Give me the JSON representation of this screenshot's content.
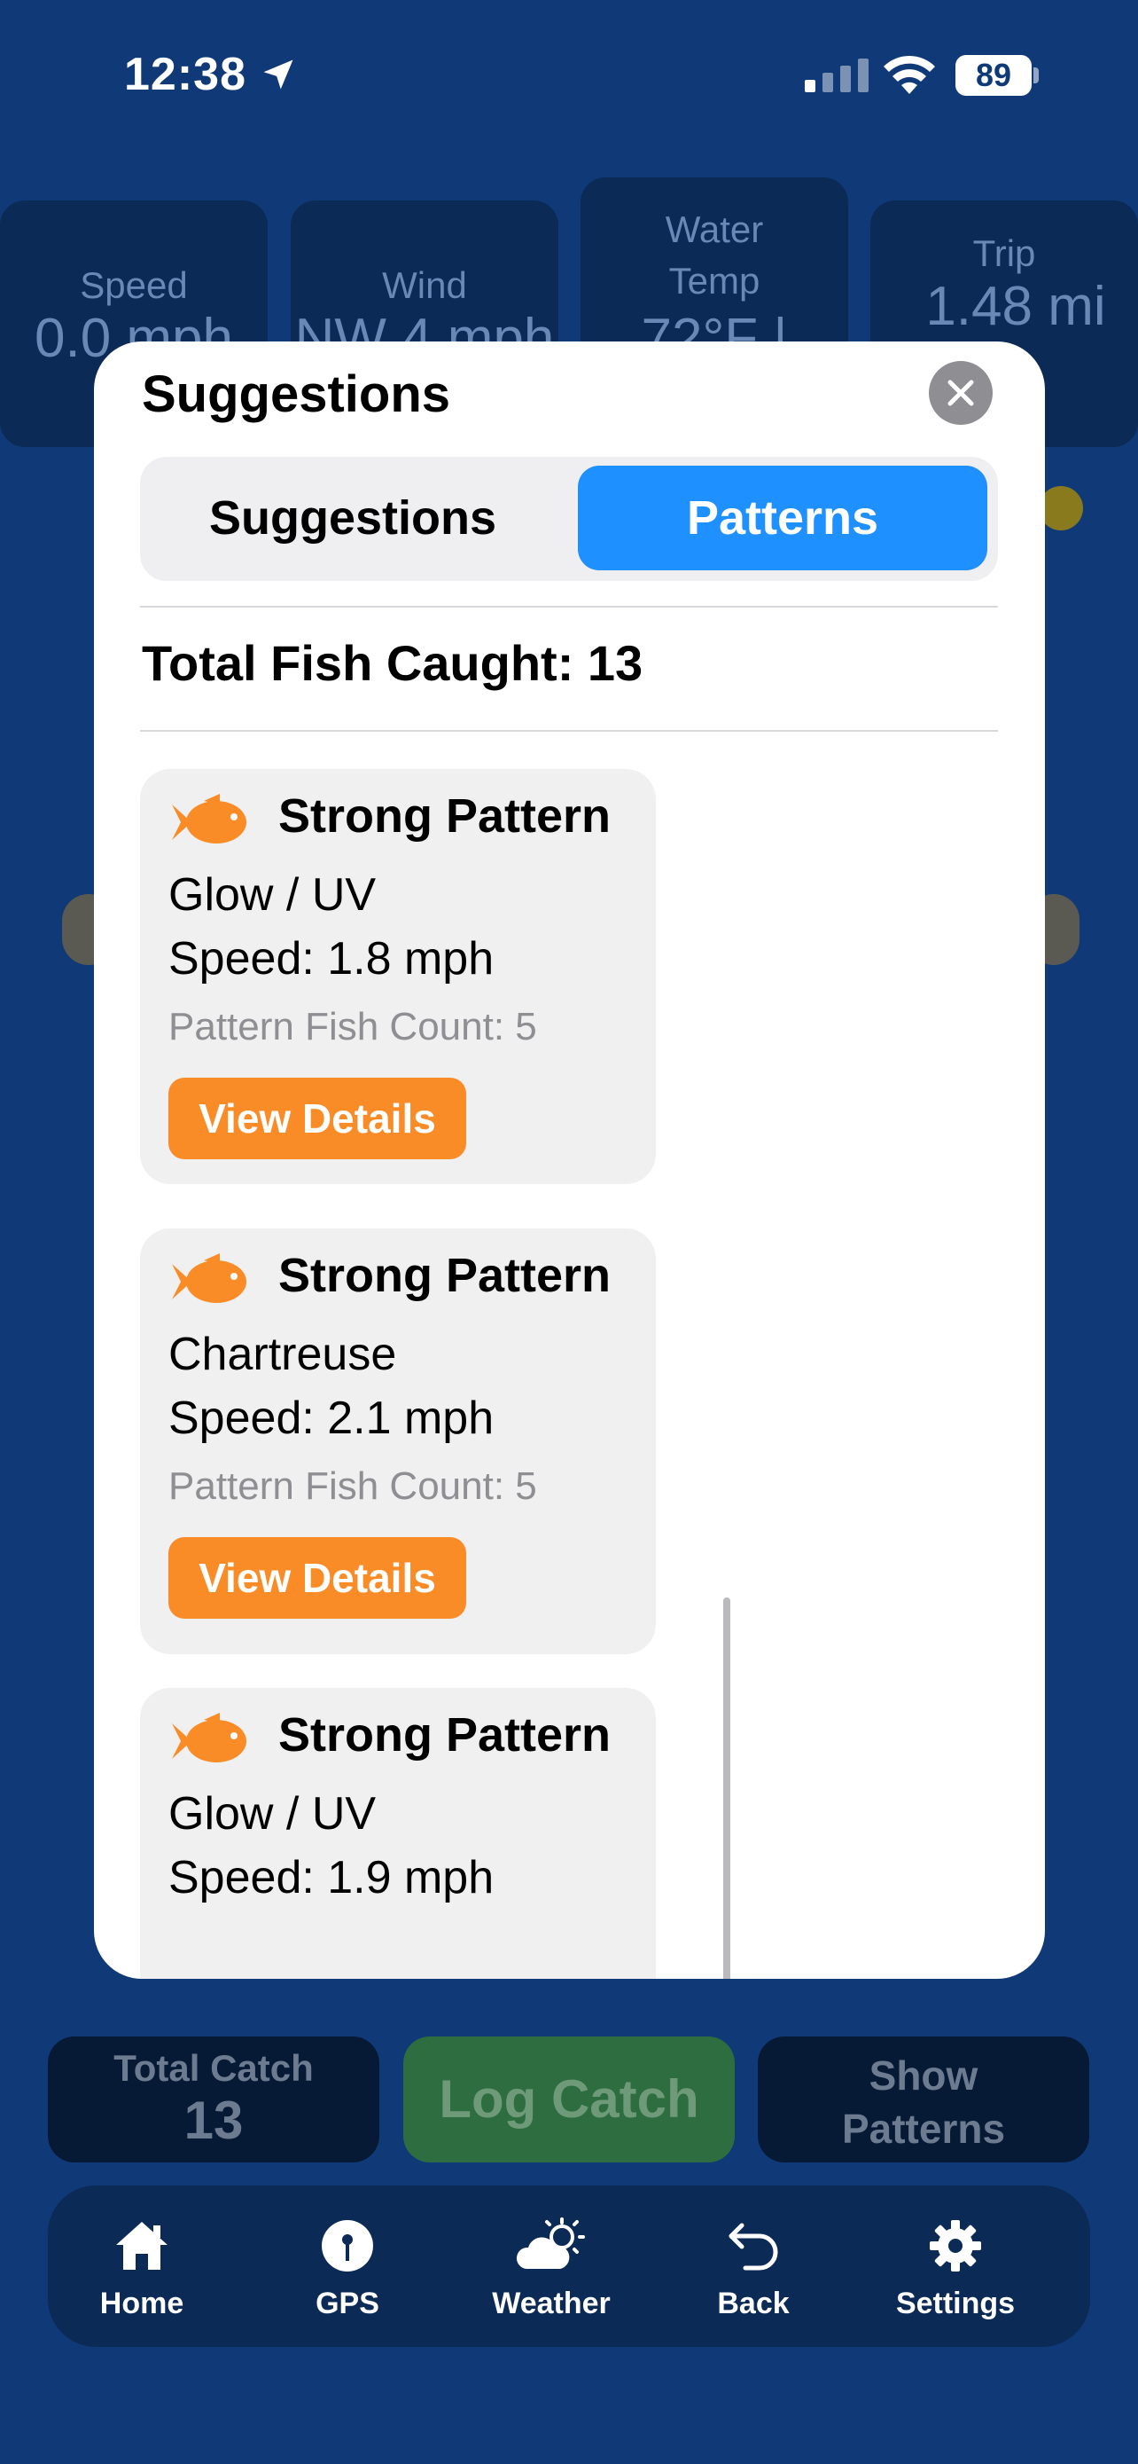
{
  "status_bar": {
    "time": "12:38",
    "battery": "89"
  },
  "background": {
    "stats": [
      {
        "label": "Speed",
        "value": "0.0 mph"
      },
      {
        "label": "Wind",
        "value": "NW 4 mph"
      },
      {
        "label": "Water Temp",
        "value": "72°F |"
      },
      {
        "label": "Trip",
        "value": "1.48 mi"
      }
    ],
    "total_catch_label": "Total Catch",
    "total_catch_value": "13",
    "log_catch_label": "Log Catch",
    "show_patterns_label": "Show Patterns"
  },
  "modal": {
    "title": "Suggestions",
    "tabs": [
      {
        "label": "Suggestions",
        "selected": false
      },
      {
        "label": "Patterns",
        "selected": true
      }
    ],
    "total_fish_label": "Total Fish Caught: 13",
    "patterns": [
      {
        "title": "Strong Pattern",
        "lure": "Glow / UV",
        "speed": "Speed: 1.8 mph",
        "count": "Pattern Fish Count: 5",
        "button": "View Details"
      },
      {
        "title": "Strong Pattern",
        "lure": "Chartreuse",
        "speed": "Speed:  2.1 mph",
        "count": "Pattern Fish Count: 5",
        "button": "View Details"
      },
      {
        "title": "Strong Pattern",
        "lure": "Glow / UV",
        "speed": "Speed: 1.9 mph",
        "count": "",
        "button": ""
      }
    ]
  },
  "tabbar": {
    "items": [
      {
        "label": "Home",
        "icon": "house-icon"
      },
      {
        "label": "GPS",
        "icon": "gps-pin-icon"
      },
      {
        "label": "Weather",
        "icon": "cloud-sun-icon"
      },
      {
        "label": "Back",
        "icon": "back-arrow-icon"
      },
      {
        "label": "Settings",
        "icon": "gear-icon"
      }
    ]
  },
  "colors": {
    "accent": "#1e90ff",
    "orange": "#fa8c28",
    "background": "#0f3a77",
    "panel": "#0b2a55"
  }
}
